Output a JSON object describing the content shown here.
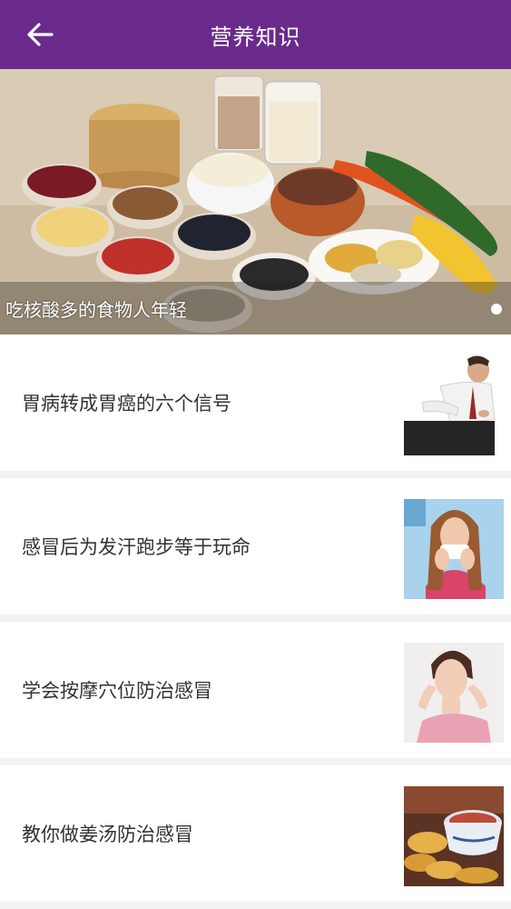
{
  "header": {
    "title": "营养知识",
    "back_icon": "arrow-left-icon"
  },
  "banner": {
    "caption": "吃核酸多的食物人年轻",
    "page_indicator": {
      "count": 1,
      "active": 1
    }
  },
  "articles": [
    {
      "title": "胃病转成胃癌的六个信号",
      "thumbnail": "man-stomach-pain-image"
    },
    {
      "title": "感冒后为发汗跑步等于玩命",
      "thumbnail": "woman-sneezing-image"
    },
    {
      "title": "学会按摩穴位防治感冒",
      "thumbnail": "woman-headache-image"
    },
    {
      "title": "教你做姜汤防治感冒",
      "thumbnail": "ginger-soup-image"
    }
  ],
  "colors": {
    "header_bg": "#6a2a8c",
    "page_bg": "#f2f2f2",
    "item_bg": "#ffffff",
    "item_text": "#333333"
  }
}
